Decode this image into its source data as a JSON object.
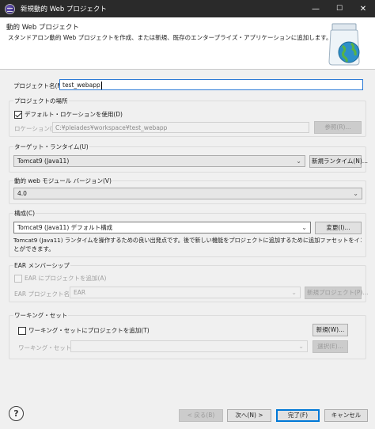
{
  "window": {
    "title": "新規動的 Web プロジェクト",
    "minimize": "—",
    "maximize": "☐",
    "close": "✕"
  },
  "header": {
    "title": "動的 Web プロジェクト",
    "description": "スタンドアロン動的 Web プロジェクトを作成、または新規、既存のエンタープライズ・アプリケーションに追加します。",
    "icon": "jar-globe-icon"
  },
  "project_name": {
    "label": "プロジェクト名(M):",
    "value": "test_webapp"
  },
  "location": {
    "group_label": "プロジェクトの場所",
    "use_default_label": "デフォルト・ロケーションを使用(D)",
    "use_default_checked": true,
    "location_label": "ロケーション(L):",
    "location_value": "C:¥pleiades¥workspace¥test_webapp",
    "browse_label": "参照(R)..."
  },
  "target_runtime": {
    "group_label": "ターゲット・ランタイム(U)",
    "selected": "Tomcat9 (Java11)",
    "new_runtime_label": "新規ランタイム(N)..."
  },
  "module_version": {
    "group_label": "動的 web モジュール バージョン(V)",
    "selected": "4.0"
  },
  "configuration": {
    "group_label": "構成(C)",
    "selected": "Tomcat9 (Java11) デフォルト構成",
    "modify_label": "変更(I)...",
    "info_line1": "Tomcat9 (Java11) ランタイムを操作するための良い出発点です。後で新しい機能をプロジェクトに追加するために追加ファセットをインストールするこ",
    "info_line2": "とができます。"
  },
  "ear": {
    "group_label": "EAR メンバーシップ",
    "add_label": "EAR にプロジェクトを追加(A)",
    "add_checked": false,
    "project_name_label": "EAR プロジェクト名(E):",
    "project_name_value": "EAR",
    "new_project_label": "新規プロジェクト(P)..."
  },
  "working_set": {
    "group_label": "ワーキング・セット",
    "add_label": "ワーキング・セットにプロジェクトを追加(T)",
    "add_checked": false,
    "new_label": "新規(W)...",
    "set_label": "ワーキング・セット(O):",
    "set_value": "",
    "select_label": "選択(E)..."
  },
  "footer": {
    "back_label": "< 戻る(B)",
    "next_label": "次へ(N) >",
    "finish_label": "完了(F)",
    "cancel_label": "キャンセル",
    "help_icon": "?"
  },
  "colors": {
    "titlebar": "#2a2a2a",
    "focus_border": "#2c7ad6",
    "default_button_border": "#0078d7"
  }
}
